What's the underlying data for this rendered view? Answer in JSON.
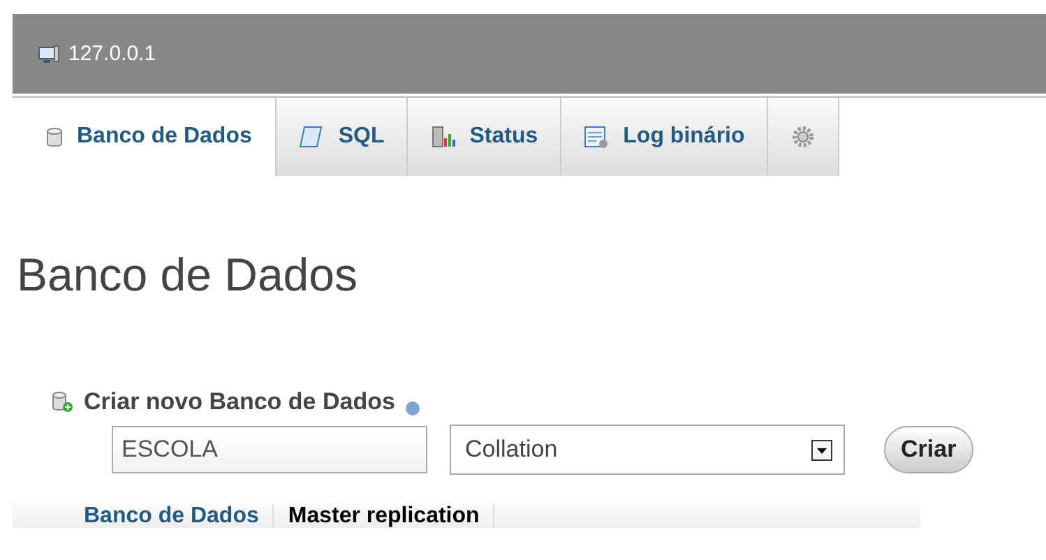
{
  "server": {
    "title": "127.0.0.1"
  },
  "tabs": [
    {
      "label": "Banco de Dados",
      "kind": "database",
      "selected": true
    },
    {
      "label": "SQL",
      "kind": "sql",
      "selected": false
    },
    {
      "label": "Status",
      "kind": "status",
      "selected": false
    },
    {
      "label": "Log binário",
      "kind": "log",
      "selected": false
    },
    {
      "kind": "settings",
      "selected": false
    }
  ],
  "heading": "Banco de Dados",
  "create": {
    "title": "Criar novo Banco de Dados",
    "name_value": "ESCOLA",
    "collation_placeholder": "Collation",
    "button": "Criar"
  },
  "table": {
    "columns": [
      "Banco de Dados",
      "Master replication"
    ]
  }
}
